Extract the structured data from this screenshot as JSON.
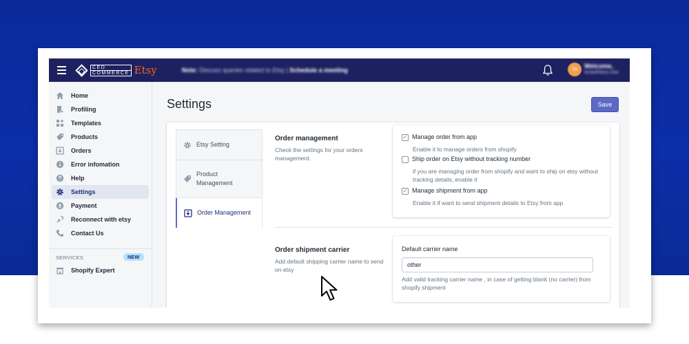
{
  "topbar": {
    "logo_top": "CED",
    "logo_bottom": "COMMERCE",
    "logo_brand": "Etsy",
    "note_prefix": "Note:",
    "note_text": "Discuss queries related to Etsy |",
    "note_link": "Schedule a meeting",
    "avatar_initials": "TA",
    "welcome_title": "Welcome,",
    "welcome_sub": "testwithtest.new"
  },
  "sidebar": {
    "items": [
      {
        "label": "Home",
        "icon": "home-icon"
      },
      {
        "label": "Profiling",
        "icon": "profiling-icon"
      },
      {
        "label": "Templates",
        "icon": "templates-icon"
      },
      {
        "label": "Products",
        "icon": "tag-icon"
      },
      {
        "label": "Orders",
        "icon": "orders-icon"
      },
      {
        "label": "Error infomation",
        "icon": "info-icon"
      },
      {
        "label": "Help",
        "icon": "help-icon"
      },
      {
        "label": "Settings",
        "icon": "gear-icon",
        "active": true
      },
      {
        "label": "Payment",
        "icon": "dollar-icon"
      },
      {
        "label": "Reconnect with etsy",
        "icon": "reconnect-icon"
      },
      {
        "label": "Contact Us",
        "icon": "phone-icon"
      }
    ],
    "services_label": "SERVICES",
    "services_badge": "NEW",
    "services_item": "Shopify Expert"
  },
  "main": {
    "title": "Settings",
    "save_label": "Save",
    "tabs": [
      {
        "label": "Etsy Setting",
        "icon": "gear-icon"
      },
      {
        "label": "Product Management",
        "icon": "tag-icon"
      },
      {
        "label": "Order Management",
        "icon": "download-icon",
        "active": true
      }
    ],
    "order_management": {
      "title": "Order management",
      "description": "Check the settings for your orders management.",
      "options": [
        {
          "label": "Manage order from app",
          "help": "Enable it to manage orders from shopify",
          "checked": true
        },
        {
          "label": "Ship order on Etsy without tracking number",
          "help": "if you are managing order from shopify and want to ship on etsy without tracking details, enable it",
          "checked": false
        },
        {
          "label": "Manage shipment from app",
          "help": "Enable it if want to send shipment details to Etsy from app",
          "checked": true
        }
      ]
    },
    "shipment_carrier": {
      "title": "Order shipment carrier",
      "description": "Add default shipping carrier name to send on etsy",
      "field_label": "Default carrier name",
      "field_value": "other",
      "field_help": "Add valid tracking carrier name , in case of getting blank (no carrier) from shopify shipment"
    }
  },
  "colors": {
    "background_blue": "#0b2fa8",
    "topbar": "#1e2160",
    "accent": "#5c6ac4",
    "etsy_orange": "#f1641e"
  }
}
